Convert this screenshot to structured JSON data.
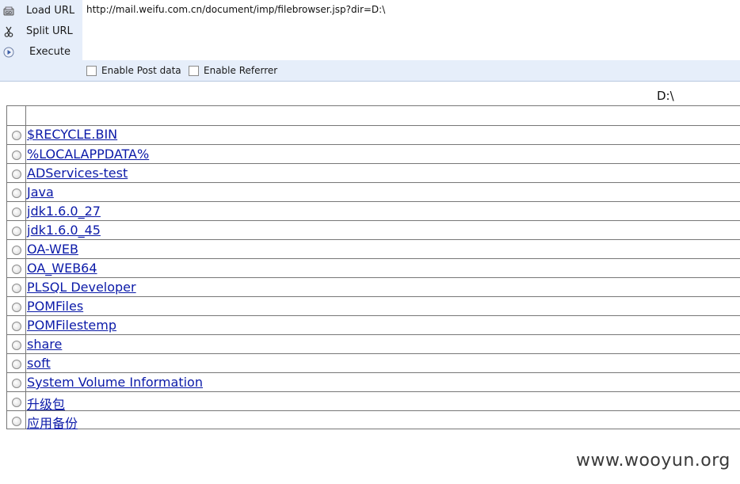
{
  "toolbar": {
    "load_label": "Load URL",
    "split_label": "Split URL",
    "execute_label": "Execute",
    "url_value": "http://mail.weifu.com.cn/document/imp/filebrowser.jsp?dir=D:\\",
    "post_label": "Enable Post data",
    "referrer_label": "Enable Referrer"
  },
  "browser": {
    "current_dir": "D:\\",
    "entries": [
      "$RECYCLE.BIN",
      "%LOCALAPPDATA%",
      "ADServices-test",
      "Java",
      "jdk1.6.0_27",
      "jdk1.6.0_45",
      "OA-WEB",
      "OA_WEB64",
      "PLSQL Developer",
      "POMFiles",
      "POMFilestemp",
      "share",
      "soft",
      "System Volume Information",
      "升级包",
      "应用备份"
    ],
    "link_color": "#0b1aa8"
  },
  "watermark": "www.wooyun.org"
}
